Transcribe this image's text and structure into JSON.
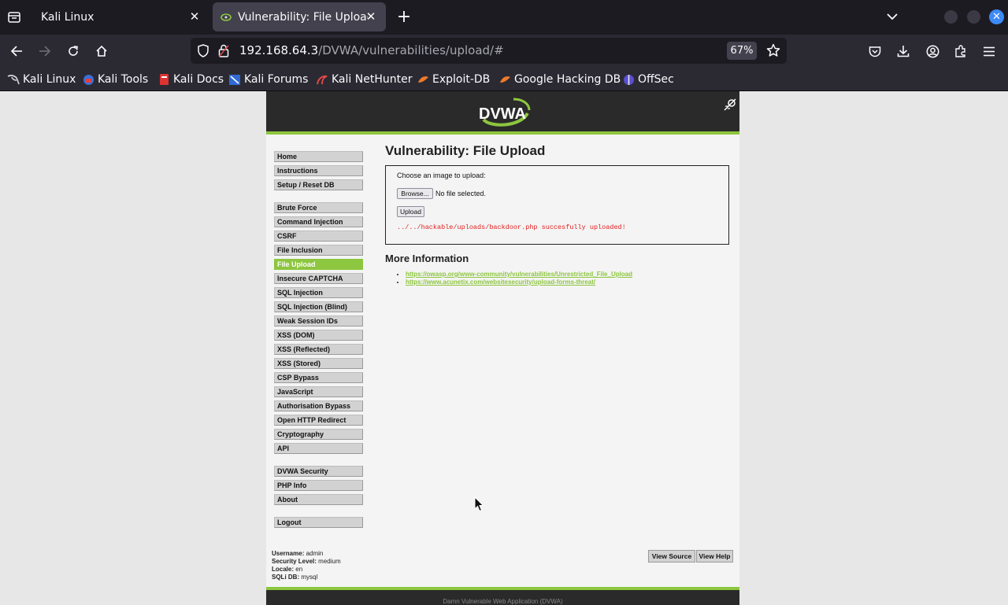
{
  "browser": {
    "tabs": [
      {
        "title": "Kali Linux",
        "active": false
      },
      {
        "title": "Vulnerability: File Upload",
        "active": true
      }
    ],
    "url": {
      "host": "192.168.64.3",
      "path": "/DVWA/vulnerabilities/upload/#"
    },
    "zoom": "67%",
    "bookmarks": [
      {
        "label": "Kali Linux",
        "icon": "kali-dragon-icon"
      },
      {
        "label": "Kali Tools",
        "icon": "kali-tools-icon"
      },
      {
        "label": "Kali Docs",
        "icon": "kali-docs-icon"
      },
      {
        "label": "Kali Forums",
        "icon": "kali-forums-icon"
      },
      {
        "label": "Kali NetHunter",
        "icon": "nethunter-icon"
      },
      {
        "label": "Exploit-DB",
        "icon": "exploit-db-icon"
      },
      {
        "label": "Google Hacking DB",
        "icon": "ghdb-icon"
      },
      {
        "label": "OffSec",
        "icon": "offsec-icon"
      }
    ],
    "colors": {
      "chrome_dark": "#1c1b22",
      "toolbar": "#2b2a33",
      "close_blue": "#3d8af7"
    }
  },
  "dvwa": {
    "logo_text": "DVWA",
    "menu_groups": [
      [
        "Home",
        "Instructions",
        "Setup / Reset DB"
      ],
      [
        "Brute Force",
        "Command Injection",
        "CSRF",
        "File Inclusion",
        "File Upload",
        "Insecure CAPTCHA",
        "SQL Injection",
        "SQL Injection (Blind)",
        "Weak Session IDs",
        "XSS (DOM)",
        "XSS (Reflected)",
        "XSS (Stored)",
        "CSP Bypass",
        "JavaScript",
        "Authorisation Bypass",
        "Open HTTP Redirect",
        "Cryptography",
        "API"
      ],
      [
        "DVWA Security",
        "PHP Info",
        "About"
      ],
      [
        "Logout"
      ]
    ],
    "selected_menu": "File Upload",
    "page_title": "Vulnerability: File Upload",
    "form": {
      "choose_label": "Choose an image to upload:",
      "browse_label": "Browse...",
      "no_file_text": "No file selected.",
      "upload_label": "Upload",
      "result_message": "../../hackable/uploads/backdoor.php succesfully uploaded!"
    },
    "more_info_heading": "More Information",
    "links": [
      "https://owasp.org/www-community/vulnerabilities/Unrestricted_File_Upload",
      "https://www.acunetix.com/websitesecurity/upload-forms-threat/"
    ],
    "user_info": {
      "username_label": "Username:",
      "username": "admin",
      "security_label": "Security Level:",
      "security": "medium",
      "locale_label": "Locale:",
      "locale": "en",
      "sqli_label": "SQLi DB:",
      "sqli_db": "mysql"
    },
    "view_source_label": "View Source",
    "view_help_label": "View Help",
    "footer_text": "Damn Vulnerable Web Application (DVWA)",
    "colors": {
      "accent_green": "#8dc63f",
      "header_bg": "#2a2a2a",
      "error_red": "#e02020"
    }
  }
}
